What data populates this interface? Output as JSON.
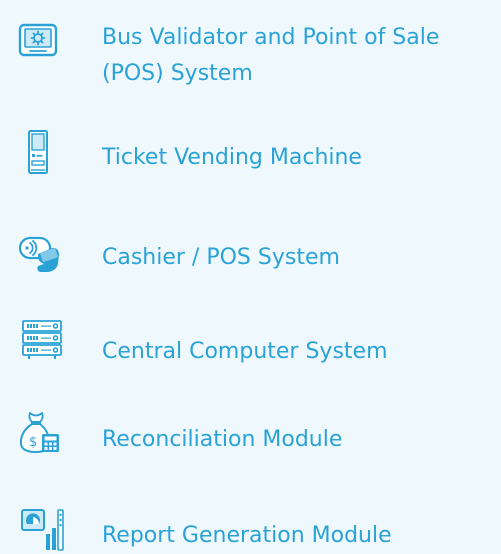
{
  "items": [
    {
      "label_line1": "Bus Validator and Point of Sale",
      "label_line2": "(POS) System",
      "icon": "validator-icon"
    },
    {
      "label": "Ticket Vending Machine",
      "icon": "vending-machine-icon"
    },
    {
      "label": "Cashier / POS System",
      "icon": "contactless-card-icon"
    },
    {
      "label": "Central Computer System",
      "icon": "server-rack-icon"
    },
    {
      "label": "Reconciliation Module",
      "icon": "money-bag-calculator-icon"
    },
    {
      "label": "Report Generation Module",
      "icon": "report-chart-icon"
    }
  ],
  "colors": {
    "background": "#eff9fd",
    "accent": "#2aa2d6"
  }
}
